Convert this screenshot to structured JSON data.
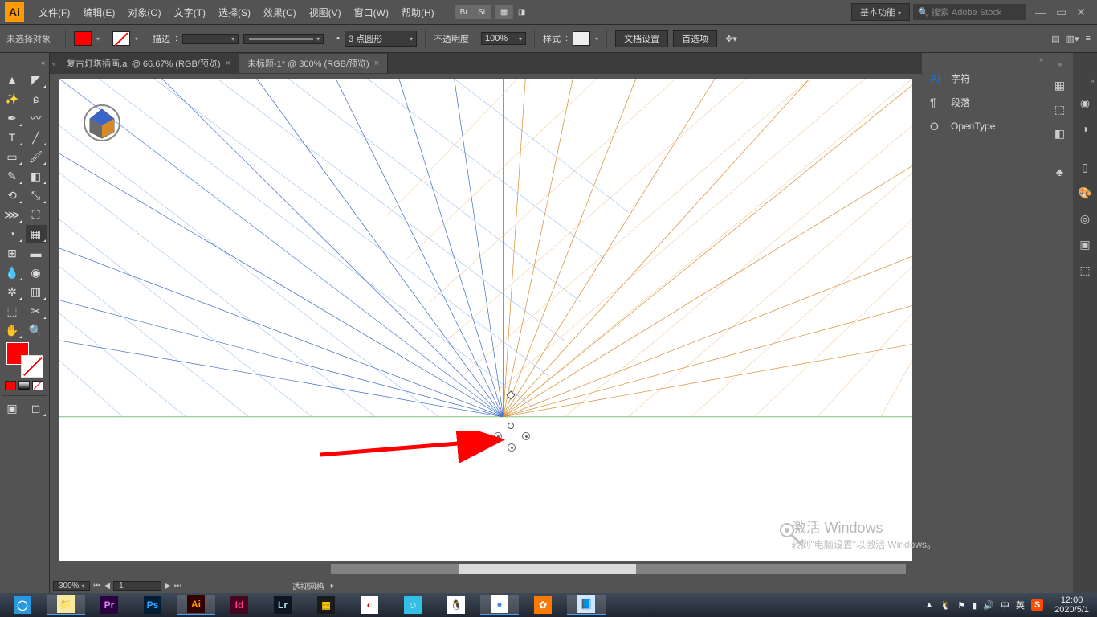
{
  "menubar": {
    "items": [
      "文件(F)",
      "编辑(E)",
      "对象(O)",
      "文字(T)",
      "选择(S)",
      "效果(C)",
      "视图(V)",
      "窗口(W)",
      "帮助(H)"
    ],
    "workspace": "基本功能",
    "search_placeholder": "搜索 Adobe Stock",
    "ext1": "Br",
    "ext2": "St"
  },
  "optbar": {
    "selection": "未选择对象",
    "stroke_label": "描边",
    "stroke_value": "",
    "brush_value": "3 点圆形",
    "opacity_label": "不透明度",
    "opacity_value": "100%",
    "style_label": "样式",
    "doc_setup": "文档设置",
    "prefs": "首选项"
  },
  "tabs": [
    {
      "label": "复古灯塔插画.ai @ 66.67% (RGB/预览)",
      "active": false
    },
    {
      "label": "未标题-1* @ 300% (RGB/预览)",
      "active": true
    }
  ],
  "panels": {
    "char": "字符",
    "para": "段落",
    "ot": "OpenType"
  },
  "status": {
    "zoom": "300%",
    "artboard": "1",
    "mode": "透视网格"
  },
  "activate": {
    "title": "激活 Windows",
    "subtitle": "转到\"电脑设置\"以激活 Windows。"
  },
  "clock": {
    "time": "12:00",
    "date": "2020/5/1"
  },
  "tray": {
    "up": "▲",
    "ime1": "中",
    "ime2": "英",
    "sogou": "S"
  },
  "task_apps": [
    {
      "bg": "#2898e0",
      "fg": "#fff",
      "txt": "◯",
      "on": false
    },
    {
      "bg": "#f7e9a0",
      "fg": "#8a6",
      "txt": "📁",
      "on": true
    },
    {
      "bg": "#2a003f",
      "fg": "#e085ff",
      "txt": "Pr",
      "on": false
    },
    {
      "bg": "#001e36",
      "fg": "#31a8ff",
      "txt": "Ps",
      "on": false
    },
    {
      "bg": "#330000",
      "fg": "#ff9a00",
      "txt": "Ai",
      "on": true
    },
    {
      "bg": "#49021f",
      "fg": "#ff3e8a",
      "txt": "Id",
      "on": false
    },
    {
      "bg": "#0b1620",
      "fg": "#b4dcf0",
      "txt": "Lr",
      "on": false
    },
    {
      "bg": "#1a1a1a",
      "fg": "#ffcc00",
      "txt": "▦",
      "on": false
    },
    {
      "bg": "#ffffff",
      "fg": "#d00",
      "txt": "◐",
      "on": false
    },
    {
      "bg": "#34bfe6",
      "fg": "#fff",
      "txt": "☺",
      "on": false
    },
    {
      "bg": "#ffffff",
      "fg": "#000",
      "txt": "🐧",
      "on": false
    },
    {
      "bg": "#ffffff",
      "fg": "#4285f4",
      "txt": "●",
      "on": true
    },
    {
      "bg": "#ff7a00",
      "fg": "#fff",
      "txt": "✿",
      "on": false
    },
    {
      "bg": "#cfe8ff",
      "fg": "#2367a8",
      "txt": "📘",
      "on": true
    }
  ]
}
